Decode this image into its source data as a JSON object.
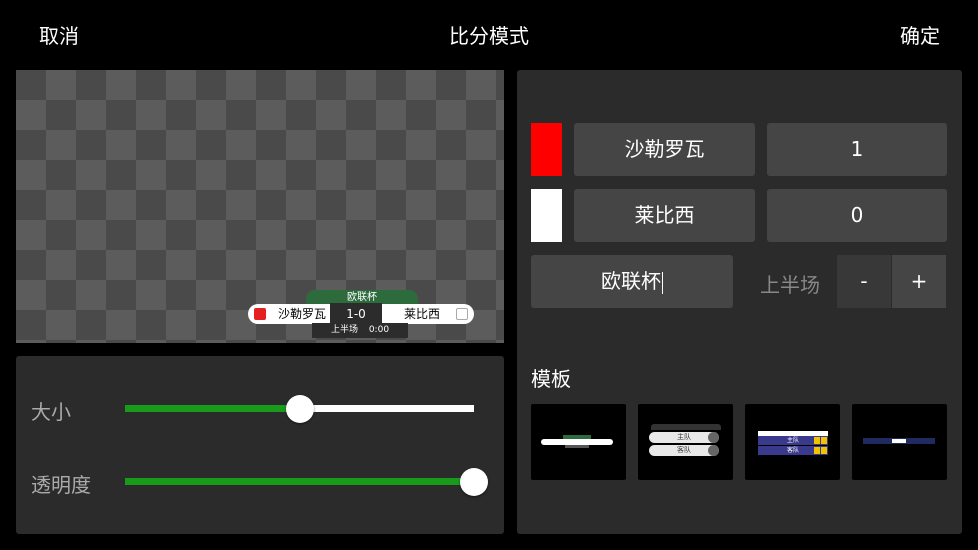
{
  "header": {
    "cancel_label": "取消",
    "title": "比分模式",
    "confirm_label": "确定"
  },
  "preview": {
    "cup_name": "欧联杯",
    "home_team": "沙勒罗瓦",
    "away_team": "莱比西",
    "score": "1-0",
    "period": "上半场",
    "time": "0:00"
  },
  "sliders": {
    "size_label": "大小",
    "size_value": 0.5,
    "opacity_label": "透明度",
    "opacity_value": 1.0
  },
  "teams": [
    {
      "color": "#ff0000",
      "name": "沙勒罗瓦",
      "score": "1"
    },
    {
      "color": "#ffffff",
      "name": "莱比西",
      "score": "0"
    }
  ],
  "match": {
    "cup_value": "欧联杯",
    "period_label": "上半场",
    "minus_label": "-",
    "plus_label": "+"
  },
  "templates": {
    "title": "模板",
    "t2_home": "主队",
    "t2_away": "客队",
    "t3_home": "主队",
    "t3_away": "客队"
  },
  "colors": {
    "accent_green": "#1a9a1a",
    "panel_bg": "#2b2b2b",
    "field_bg": "#454545"
  }
}
